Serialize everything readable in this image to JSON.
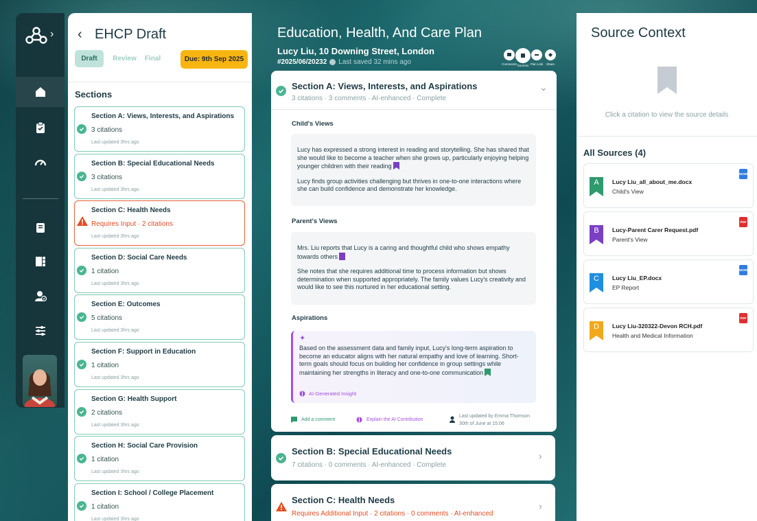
{
  "sidebar": {
    "nav_icons": [
      "home-icon",
      "clipboard-check-icon",
      "dashboard-gauge-icon",
      "notebook-icon",
      "layout-grid-icon",
      "user-check-icon",
      "sliders-icon"
    ]
  },
  "sections_panel": {
    "title": "EHCP Draft",
    "stages": [
      "Draft",
      "Review",
      "Final"
    ],
    "active_stage": "Draft",
    "due": "Due: 9th Sep 2025",
    "heading": "Sections",
    "items": [
      {
        "title": "Section A: Views, Interests, and Aspirations",
        "count": "3 citations",
        "updated": "Last updated 3hrs ago",
        "status": "complete"
      },
      {
        "title": "Section B: Special Educational Needs",
        "count": "3 citations",
        "updated": "Last updated 3hrs ago",
        "status": "complete"
      },
      {
        "title": "Section C: Health Needs",
        "count": "Requires Input · 2 citations",
        "updated": "Last updated 3hrs ago",
        "status": "warning"
      },
      {
        "title": "Section D: Social Care Needs",
        "count": "1 citation",
        "updated": "Last updated 3hrs ago",
        "status": "complete"
      },
      {
        "title": "Section E: Outcomes",
        "count": "5 citations",
        "updated": "Last updated 3hrs ago",
        "status": "complete"
      },
      {
        "title": "Section F: Support in Education",
        "count": "1 citation",
        "updated": "Last updated 3hrs ago",
        "status": "complete"
      },
      {
        "title": "Section G: Health Support",
        "count": "2 citations",
        "updated": "Last updated 3hrs ago",
        "status": "complete"
      },
      {
        "title": "Section H: Social Care Provision",
        "count": "1 citation",
        "updated": "Last updated 3hrs ago",
        "status": "complete"
      },
      {
        "title": "Section I: School / College Placement",
        "count": "1 citation",
        "updated": "Last updated 3hrs ago",
        "status": "complete"
      }
    ]
  },
  "main": {
    "title": "Education, Health, And Care Plan",
    "subtitle": "Lucy Liu, 10 Downing Street, London",
    "ref": "#2025/06/20232",
    "saved": "Last saved 32 mins ago",
    "tools": [
      "Comments",
      "Sources",
      "Plan Link",
      "Share"
    ],
    "section_a": {
      "title": "Section A: Views, Interests, and Aspirations",
      "meta": "3 citations · 3 comments · AI-enhanced · Complete",
      "childs_views_heading": "Child's Views",
      "childs_views_p1": "Lucy has expressed a strong interest in reading and storytelling. She has shared that she would like to become a teacher when she grows up, particularly enjoying helping younger children with their reading",
      "childs_views_p2": "Lucy finds group activities challenging but thrives in one-to-one interactions where she can build confidence and demonstrate her knowledge.",
      "parents_views_heading": "Parent's Views",
      "parents_views_p1": "Mrs. Liu reports that Lucy is a caring and thoughtful child who shows empathy towards others",
      "parents_views_p2": "She notes that she requires additional time to process information but shows determination when supported appropriately. The family values Lucy's creativity and would like to see this nurtured in her educational setting.",
      "aspirations_heading": "Aspirations",
      "aspirations_text": "Based on the assessment data and family input, Lucy's long-term aspiration to become an educator aligns with her natural empathy and love of learning. Short-term goals should focus on building her confidence in group settings while maintaining her strengths in literacy and one-to-one communication",
      "ai_tag": "AI-Generated Insight",
      "add_comment": "Add a comment",
      "explain_ai": "Explain the AI Contribution",
      "updated_by": "Last updated by Emma Thomson",
      "updated_at": "30th of June at 15:06"
    },
    "section_b": {
      "title": "Section B: Special Educational Needs",
      "meta": "7 citations · 0 comments · AI-enhanced · Complete"
    },
    "section_c": {
      "title": "Section C: Health Needs",
      "meta": "Requires Additional Input · 2 citations · 0 comments · AI-enhanced"
    }
  },
  "source_context": {
    "title": "Source Context",
    "empty_hint": "Click a citation to view the source details",
    "all_label": "All Sources (4)",
    "sources": [
      {
        "letter": "A",
        "file": "Lucy Liu_all_about_me.docx",
        "desc": "Child's View",
        "color": "#2e9a6e",
        "type": "WORD"
      },
      {
        "letter": "B",
        "file": "Lucy-Parent Carer Request.pdf",
        "desc": "Parent's View",
        "color": "#7b3fc4",
        "type": "PDF"
      },
      {
        "letter": "C",
        "file": "Lucy Liu_EP.docx",
        "desc": "EP Report",
        "color": "#1e8ee0",
        "type": "WORD"
      },
      {
        "letter": "D",
        "file": "Lucy Liu-320322-Devon RCH.pdf",
        "desc": "Health and Medical Information",
        "color": "#f2a81d",
        "type": "PDF"
      }
    ]
  },
  "colors": {
    "accent_green": "#4ab591",
    "warning": "#e44d22",
    "due_badge": "#f7b512",
    "ai_purple": "#a44fe0"
  }
}
